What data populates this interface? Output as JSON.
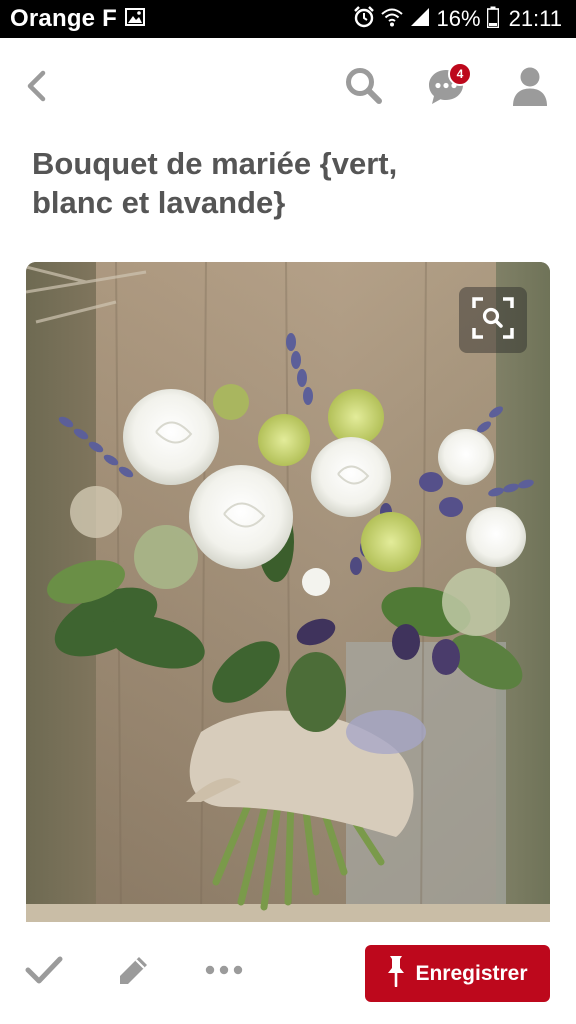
{
  "status_bar": {
    "carrier": "Orange F",
    "battery": "16%",
    "time": "21:11",
    "icons": [
      "image-notification-icon",
      "alarm-icon",
      "wifi-icon",
      "signal-icon",
      "battery-icon"
    ]
  },
  "header": {
    "icons": [
      "back-icon",
      "search-icon",
      "messages-icon",
      "profile-icon"
    ],
    "notification_count": "4"
  },
  "pin": {
    "title_line1": "Bouquet de mariée {vert,",
    "title_line2": "blanc et lavande}"
  },
  "action_bar": {
    "icons": [
      "check-icon",
      "pencil-icon",
      "more-icon",
      "pin-icon"
    ],
    "save_label": "Enregistrer"
  },
  "colors": {
    "accent": "#bd081c",
    "title": "#555555",
    "icon_gray": "#9b9b9b"
  }
}
